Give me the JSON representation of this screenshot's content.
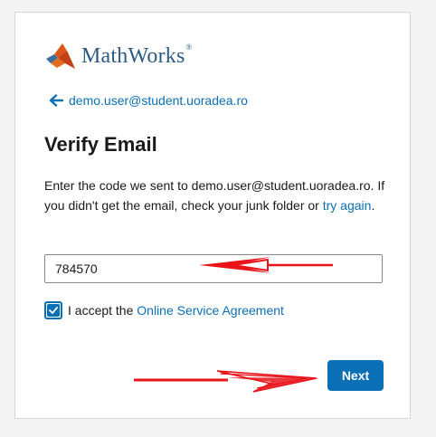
{
  "brand": {
    "name": "MathWorks",
    "registered_mark": "®",
    "color": "#2b5b84",
    "logo_icon": "matlab-membrane-logo"
  },
  "back": {
    "icon": "arrow-left-icon",
    "email": "demo.user@student.uoradea.ro"
  },
  "page": {
    "title": "Verify Email",
    "instructions_prefix": "Enter the code we sent to demo.user@student.uoradea.ro. If you didn't get the email, check your junk folder or ",
    "try_again_link": "try again",
    "instructions_suffix": "."
  },
  "code_field": {
    "value": "784570",
    "placeholder": ""
  },
  "agreement": {
    "checked": true,
    "prefix": "I accept the ",
    "link": "Online Service Agreement"
  },
  "actions": {
    "next_label": "Next"
  },
  "colors": {
    "accent": "#0b6fb6",
    "annotation_arrow": "#e8141a"
  }
}
